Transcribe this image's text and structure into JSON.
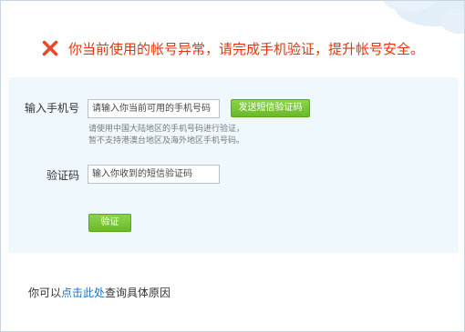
{
  "alert": {
    "icon": "close-x-icon",
    "message": "你当前使用的帐号异常，请完成手机验证，提升帐号安全。",
    "color": "#e8340c"
  },
  "form": {
    "phone_label": "输入手机号",
    "phone_placeholder": "请输入你当前可用的手机号码",
    "send_button": "发送短信验证码",
    "hint_line1": "请使用中国大陆地区的手机号码进行验证，",
    "hint_line2": "暂不支持港澳台地区及海外地区手机号码。",
    "code_label": "验证码",
    "code_placeholder": "输入你收到的短信验证码",
    "verify_button": "验证",
    "panel_color": "#eef8fd",
    "button_color": "#72c02e"
  },
  "footer": {
    "prefix": "你可以",
    "link": "点击此处",
    "suffix": "查询具体原因",
    "link_color": "#1a73c2"
  }
}
